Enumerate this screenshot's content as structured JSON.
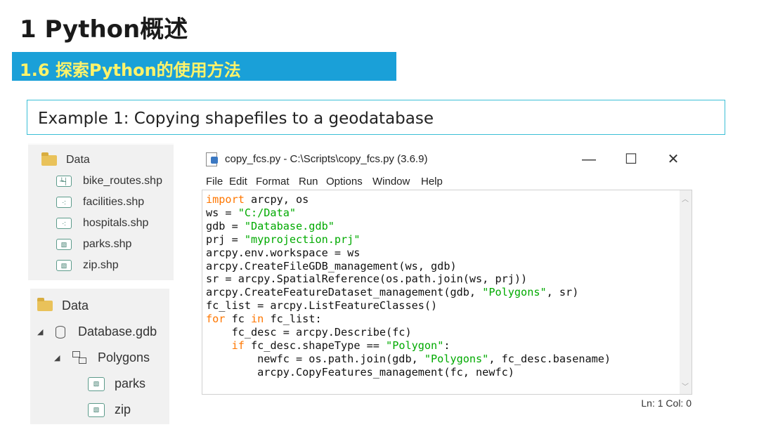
{
  "page": {
    "title": "1 Python概述",
    "section": "1.6 探索Python的使用方法",
    "example": "Example 1: Copying shapefiles to a geodatabase"
  },
  "panel1": {
    "root": "Data",
    "files": [
      "bike_routes.shp",
      "facilities.shp",
      "hospitals.shp",
      "parks.shp",
      "zip.shp"
    ]
  },
  "panel2": {
    "root": "Data",
    "gdb": "Database.gdb",
    "dataset": "Polygons",
    "features": [
      "parks",
      "zip"
    ]
  },
  "idle": {
    "title": "copy_fcs.py - C:\\Scripts\\copy_fcs.py (3.6.9)",
    "menu": [
      "File",
      "Edit",
      "Format",
      "Run",
      "Options",
      "Window",
      "Help"
    ],
    "status": "Ln: 1  Col: 0",
    "code": [
      [
        [
          "kw",
          "import"
        ],
        [
          "t",
          " arcpy, os"
        ]
      ],
      [
        [
          "t",
          "ws = "
        ],
        [
          "str",
          "\"C:/Data\""
        ]
      ],
      [
        [
          "t",
          "gdb = "
        ],
        [
          "str",
          "\"Database.gdb\""
        ]
      ],
      [
        [
          "t",
          "prj = "
        ],
        [
          "str",
          "\"myprojection.prj\""
        ]
      ],
      [
        [
          "t",
          "arcpy.env.workspace = ws"
        ]
      ],
      [
        [
          "t",
          "arcpy.CreateFileGDB_management(ws, gdb)"
        ]
      ],
      [
        [
          "t",
          "sr = arcpy.SpatialReference(os.path.join(ws, prj))"
        ]
      ],
      [
        [
          "t",
          "arcpy.CreateFeatureDataset_management(gdb, "
        ],
        [
          "str",
          "\"Polygons\""
        ],
        [
          "t",
          ", sr)"
        ]
      ],
      [
        [
          "t",
          "fc_list = arcpy.ListFeatureClasses()"
        ]
      ],
      [
        [
          "kw",
          "for"
        ],
        [
          "t",
          " fc "
        ],
        [
          "kw",
          "in"
        ],
        [
          "t",
          " fc_list:"
        ]
      ],
      [
        [
          "t",
          "    fc_desc = arcpy.Describe(fc)"
        ]
      ],
      [
        [
          "t",
          "    "
        ],
        [
          "kw",
          "if"
        ],
        [
          "t",
          " fc_desc.shapeType == "
        ],
        [
          "str",
          "\"Polygon\""
        ],
        [
          "t",
          ":"
        ]
      ],
      [
        [
          "t",
          "        newfc = os.path.join(gdb, "
        ],
        [
          "str",
          "\"Polygons\""
        ],
        [
          "t",
          ", fc_desc.basename)"
        ]
      ],
      [
        [
          "t",
          "        arcpy.CopyFeatures_management(fc, newfc)"
        ]
      ]
    ]
  }
}
